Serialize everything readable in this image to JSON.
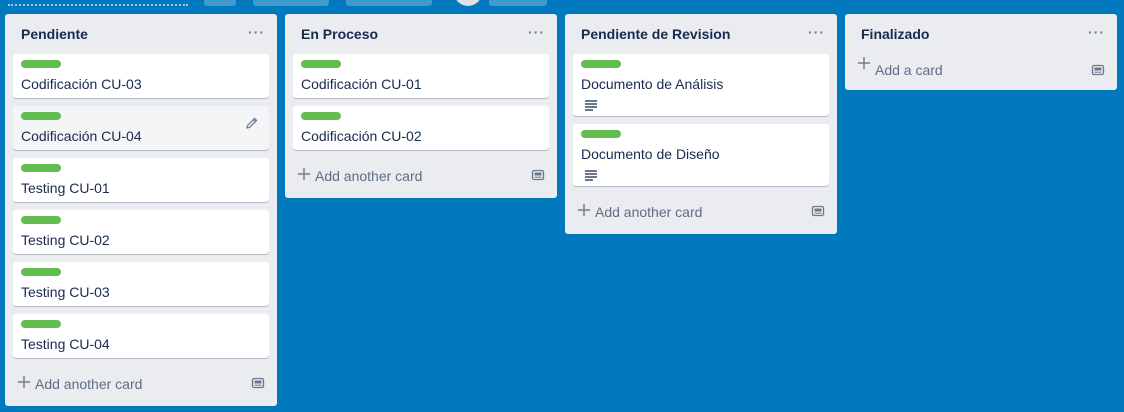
{
  "colors": {
    "board_background": "#0079bf",
    "list_background": "#ebecf0",
    "label_green": "#61bd4f"
  },
  "lists": [
    {
      "title": "Pendiente",
      "menu": "···",
      "cards": [
        {
          "title": "Codificación CU-03",
          "label": "green"
        },
        {
          "title": "Codificación CU-04",
          "label": "green",
          "hovered": true
        },
        {
          "title": "Testing CU-01",
          "label": "green"
        },
        {
          "title": "Testing CU-02",
          "label": "green"
        },
        {
          "title": "Testing CU-03",
          "label": "green"
        },
        {
          "title": "Testing CU-04",
          "label": "green"
        }
      ],
      "add_label": "Add another card"
    },
    {
      "title": "En Proceso",
      "menu": "···",
      "cards": [
        {
          "title": "Codificación CU-01",
          "label": "green"
        },
        {
          "title": "Codificación CU-02",
          "label": "green"
        }
      ],
      "add_label": "Add another card"
    },
    {
      "title": "Pendiente de Revision",
      "menu": "···",
      "cards": [
        {
          "title": "Documento de Análisis",
          "label": "green",
          "has_description": true
        },
        {
          "title": "Documento de Diseño",
          "label": "green",
          "has_description": true
        }
      ],
      "add_label": "Add another card"
    },
    {
      "title": "Finalizado",
      "menu": "···",
      "cards": [],
      "add_label": "Add a card"
    }
  ]
}
